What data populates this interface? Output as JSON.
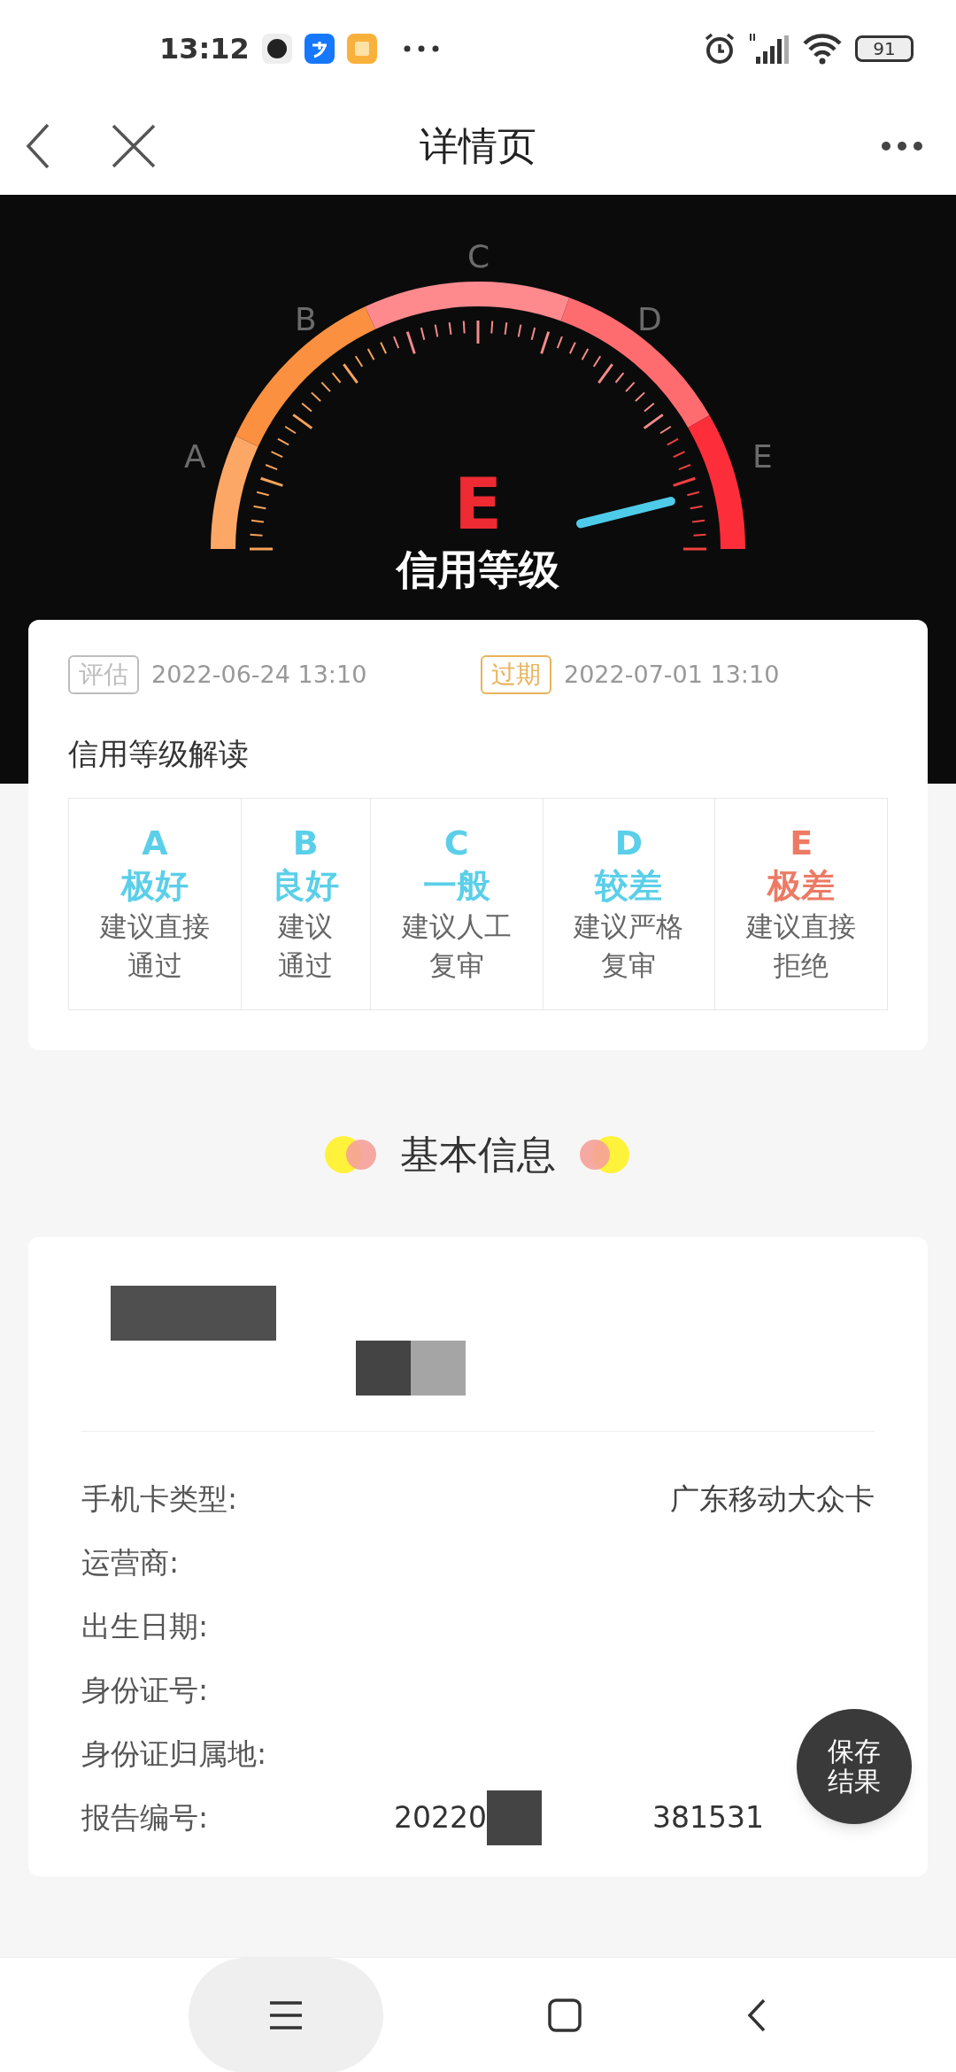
{
  "status_bar": {
    "time": "13:12",
    "battery": "91"
  },
  "nav": {
    "title": "详情页"
  },
  "gauge": {
    "grade": "E",
    "caption": "信用等级",
    "scale_labels": [
      "A",
      "B",
      "C",
      "D",
      "E"
    ]
  },
  "dates": [
    {
      "tag": "评估",
      "value": "2022-06-24 13:10",
      "color": "#bdbdbd"
    },
    {
      "tag": "过期",
      "value": "2022-07-01 13:10",
      "color": "#e8b35c"
    }
  ],
  "grade_table": {
    "title": "信用等级解读",
    "grades": [
      {
        "letter": "A",
        "quality": "极好",
        "advice": [
          "建议直接",
          "通过"
        ],
        "color": "#5bcfe9"
      },
      {
        "letter": "B",
        "quality": "良好",
        "advice": [
          "建议",
          "通过"
        ],
        "color": "#5bcfe9"
      },
      {
        "letter": "C",
        "quality": "一般",
        "advice": [
          "建议人工",
          "复审"
        ],
        "color": "#5bcfe9"
      },
      {
        "letter": "D",
        "quality": "较差",
        "advice": [
          "建议严格",
          "复审"
        ],
        "color": "#5bcfe9"
      },
      {
        "letter": "E",
        "quality": "极差",
        "advice": [
          "建议直接",
          "拒绝"
        ],
        "color": "#ec7a64"
      }
    ]
  },
  "basic_info": {
    "title": "基本信息",
    "rows": [
      {
        "label": "手机卡类型:",
        "value": [
          "广东移动大众卡"
        ]
      },
      {
        "label": "运营商:",
        "value": []
      },
      {
        "label": "出生日期:",
        "value": []
      },
      {
        "label": "身份证号:",
        "value": []
      },
      {
        "label": "身份证归属地:",
        "value": []
      },
      {
        "label": "报告编号:",
        "value": [
          "20220",
          "381531"
        ]
      }
    ]
  },
  "save_button": {
    "lines": [
      "保存",
      "结果"
    ]
  }
}
